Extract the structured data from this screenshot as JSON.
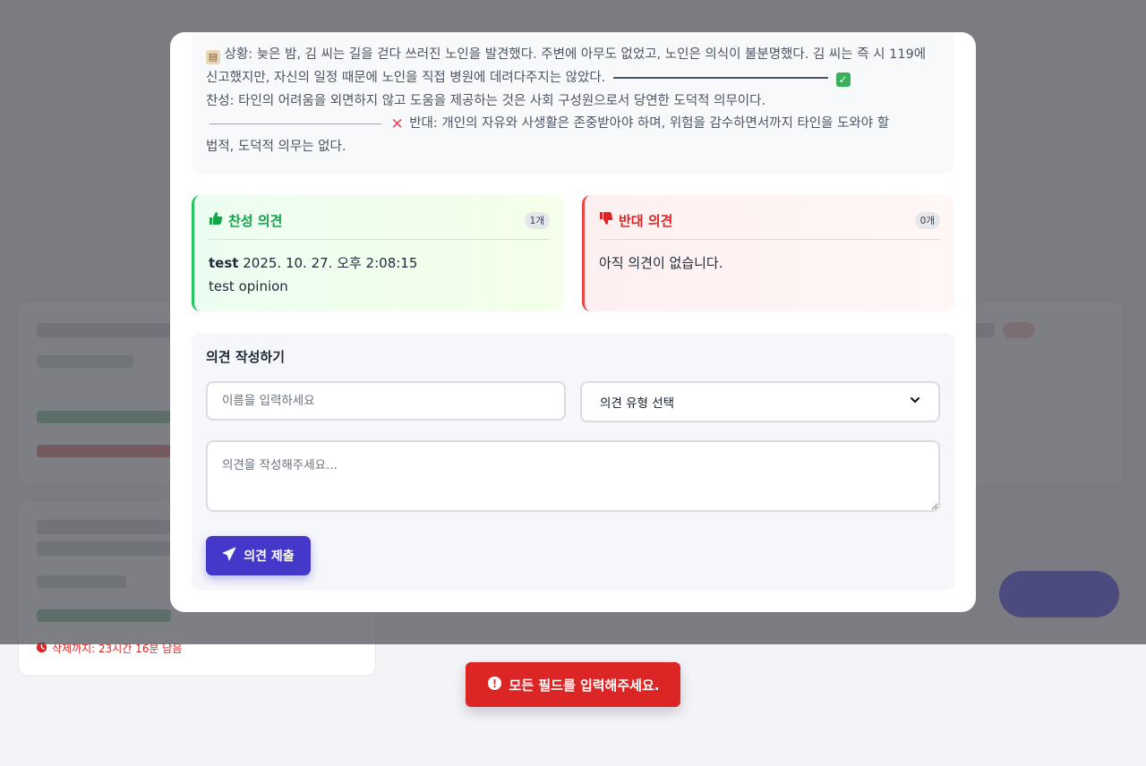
{
  "scenario": {
    "line1": "상황: 늦은 밤, 김 씨는 길을 걷다 쓰러진 노인을 발견했다. 주변에 아무도 없었고, 노인은 의식이 불분명했다. 김 씨는 즉",
    "line2": "시 119에 신고했지만, 자신의 일정 때문에 노인을 직접 병원에 데려다주지는 않았다.",
    "line3": "찬성: 타인의 어려움을 외면하지 않고 도움을 제공하는 것은 사회 구성원으로서 당연한 도덕적 의무이다.",
    "line4": "반대: 개인의 자유와 사생활은 존중받아야 하며, 위험을 감수하면서까지 타인을 도와야 할",
    "line5": "법적, 도덕적 의무는 없다."
  },
  "pro": {
    "title": "찬성 의견",
    "count": "1개",
    "opinions": [
      {
        "author": "test",
        "timestamp": "2025. 10. 27. 오후 2:08:15",
        "text": "test opinion"
      }
    ]
  },
  "con": {
    "title": "반대 의견",
    "count": "0개",
    "empty_text": "아직 의견이 없습니다."
  },
  "form": {
    "title": "의견 작성하기",
    "name_placeholder": "이름을 입력하세요",
    "type_selected": "의견 유형 선택",
    "opinion_placeholder": "의견을 작성해주세요...",
    "submit_label": "의견 제출"
  },
  "background": {
    "deadline_text": "삭제까지: 23시간 16분 남음"
  },
  "toast": {
    "message": "모든 필드를 입력해주세요."
  },
  "colors": {
    "pro": "#22c55e",
    "con": "#ef4444",
    "primary": "#4338ca",
    "toast": "#dc2626"
  },
  "icons": [
    "clipboard-icon",
    "check-icon",
    "cross-icon",
    "thumbs-up-icon",
    "thumbs-down-icon",
    "chevron-down-icon",
    "send-icon",
    "alert-icon",
    "clock-icon"
  ]
}
